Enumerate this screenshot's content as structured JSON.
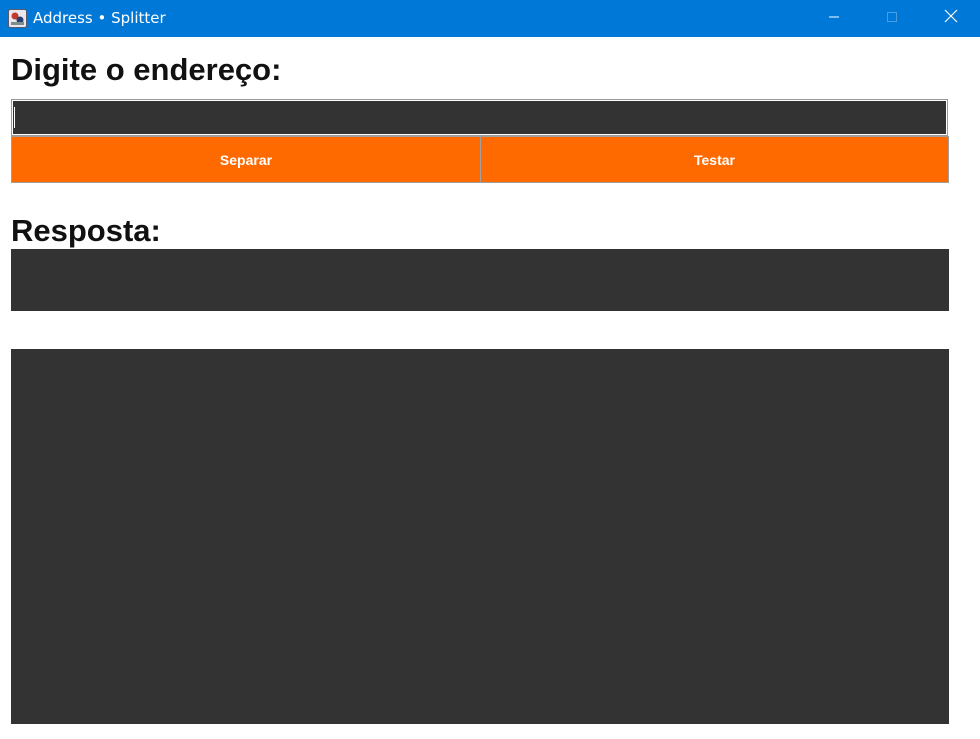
{
  "window": {
    "title": "Address • Splitter",
    "titlebar_color": "#0078d7",
    "icons": {
      "app": "java-app-icon",
      "minimize": "minimize-icon",
      "maximize": "maximize-icon",
      "close": "close-icon"
    }
  },
  "form": {
    "address_heading": "Digite o endereço:",
    "address_value": "",
    "address_placeholder": "",
    "buttons": {
      "separate_label": "Separar",
      "test_label": "Testar",
      "color": "#ff6a00"
    },
    "response_heading": "Resposta:",
    "response_line_value": "",
    "response_area_value": ""
  },
  "colors": {
    "field_background": "#333333",
    "accent": "#ff6a00"
  }
}
